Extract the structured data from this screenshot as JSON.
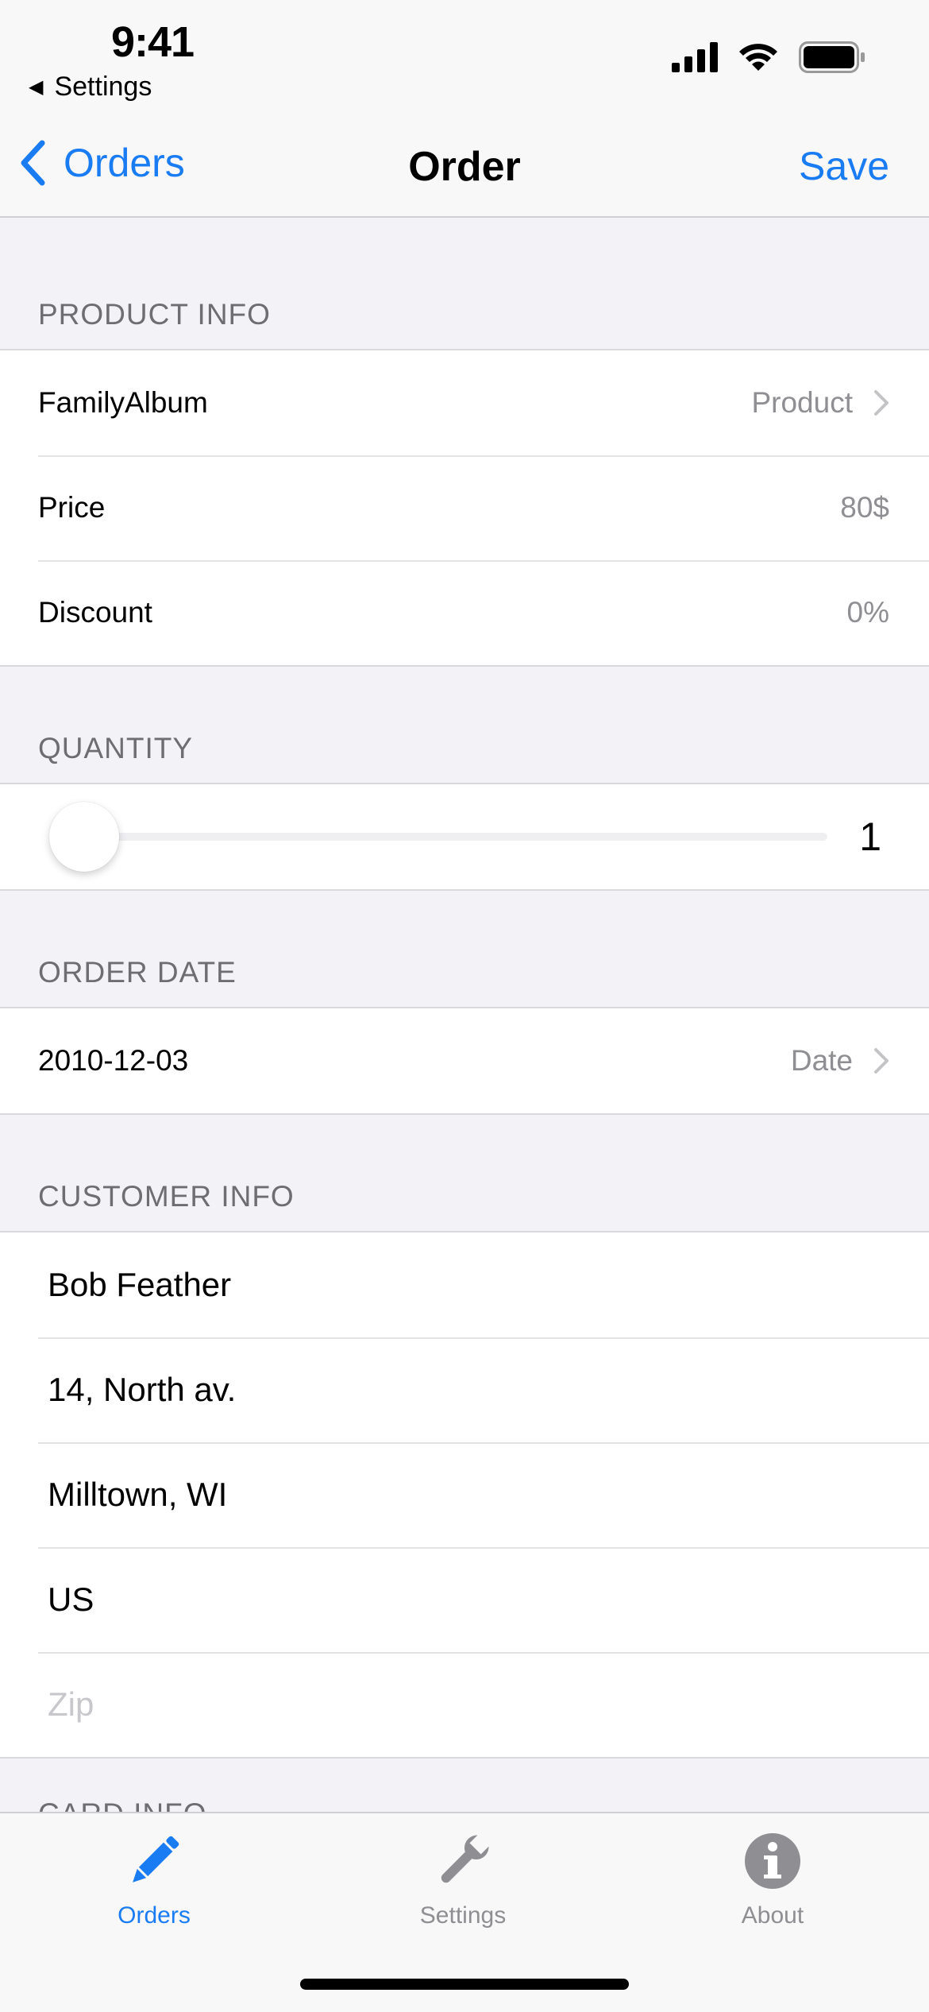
{
  "status_bar": {
    "time": "9:41",
    "back_app_label": "Settings"
  },
  "nav": {
    "back_label": "Orders",
    "title": "Order",
    "save_label": "Save"
  },
  "sections": {
    "product_info": {
      "header": "PRODUCT INFO",
      "product_name": "FamilyAlbum",
      "product_link_label": "Product",
      "price_label": "Price",
      "price_value": "80$",
      "discount_label": "Discount",
      "discount_value": "0%"
    },
    "quantity": {
      "header": "QUANTITY",
      "value": "1",
      "slider_fraction": 0.0
    },
    "order_date": {
      "header": "ORDER DATE",
      "date_value": "2010-12-03",
      "date_link_label": "Date"
    },
    "customer_info": {
      "header": "CUSTOMER INFO",
      "name": "Bob Feather",
      "address": "14, North av.",
      "city": "Milltown, WI",
      "country": "US",
      "zip_placeholder": "Zip"
    },
    "card_info": {
      "header": "CARD INFO"
    }
  },
  "tab_bar": {
    "tabs": [
      {
        "label": "Orders",
        "icon": "pencil-icon",
        "active": true
      },
      {
        "label": "Settings",
        "icon": "wrench-icon",
        "active": false
      },
      {
        "label": "About",
        "icon": "info-icon",
        "active": false
      }
    ]
  },
  "colors": {
    "accent": "#1a7cf3",
    "secondary_text": "#8e8e93",
    "background": "#f2f2f7"
  }
}
